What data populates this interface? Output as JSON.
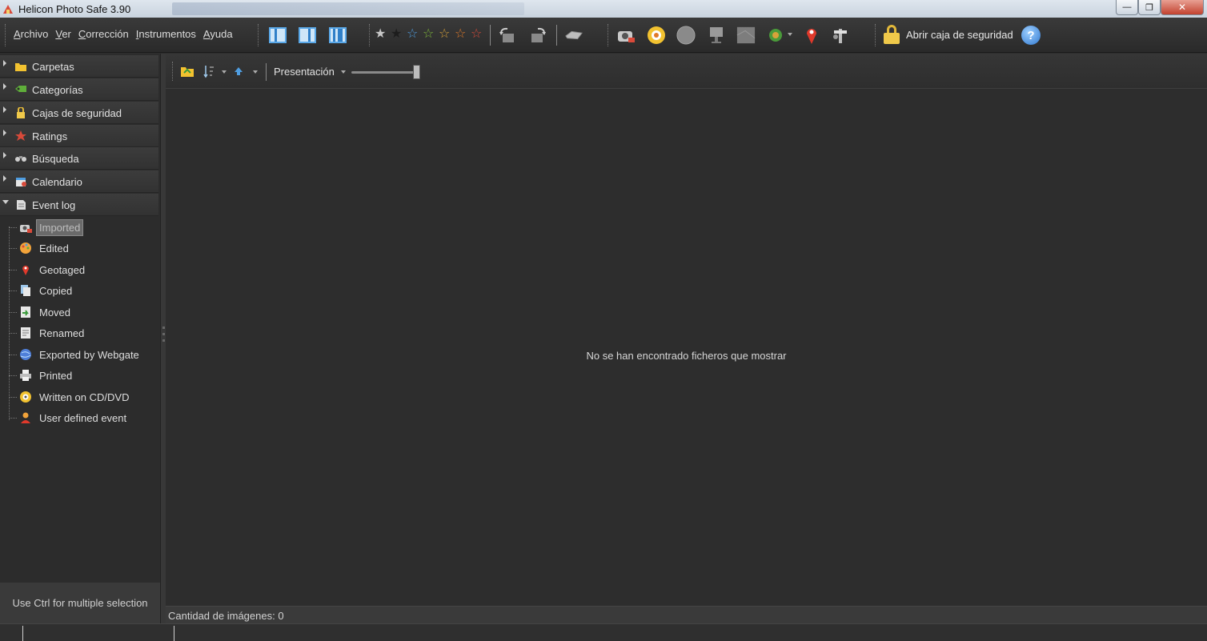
{
  "window": {
    "title": "Helicon Photo Safe 3.90",
    "minimize": "—",
    "maximize": "❐",
    "close": "✕"
  },
  "menu": [
    "Archivo",
    "Ver",
    "Corrección",
    "Instrumentos",
    "Ayuda"
  ],
  "toolbar": {
    "lock_label": "Abrir caja de seguridad",
    "help": "?",
    "star_colors": [
      "#c8c8c8",
      "#3a3a3a",
      "#4f9de0",
      "#7fb83a",
      "#d8a23a",
      "#e07a2a",
      "#d84a3a"
    ]
  },
  "sidebar": {
    "panels": [
      {
        "label": "Carpetas",
        "icon": "folder-icon"
      },
      {
        "label": "Categorías",
        "icon": "category-icon"
      },
      {
        "label": "Cajas de seguridad",
        "icon": "lock-icon"
      },
      {
        "label": "Ratings",
        "icon": "rating-icon"
      },
      {
        "label": "Búsqueda",
        "icon": "binoculars-icon"
      },
      {
        "label": "Calendario",
        "icon": "calendar-icon"
      },
      {
        "label": "Event log",
        "icon": "event-log-icon"
      }
    ],
    "events": [
      {
        "label": "Imported",
        "icon": "camera-import-icon"
      },
      {
        "label": "Edited",
        "icon": "palette-icon"
      },
      {
        "label": "Geotaged",
        "icon": "map-pin-icon"
      },
      {
        "label": "Copied",
        "icon": "copy-icon"
      },
      {
        "label": "Moved",
        "icon": "move-icon"
      },
      {
        "label": "Renamed",
        "icon": "rename-icon"
      },
      {
        "label": "Exported by Webgate",
        "icon": "globe-icon"
      },
      {
        "label": "Printed",
        "icon": "printer-icon"
      },
      {
        "label": "Written on CD/DVD",
        "icon": "disc-icon"
      },
      {
        "label": "User defined event",
        "icon": "user-icon"
      }
    ],
    "hint": "Use Ctrl for multiple selection"
  },
  "main": {
    "view_label": "Presentación",
    "empty_message": "No se han encontrado ficheros que mostrar",
    "status": "Cantidad de imágenes: 0"
  }
}
